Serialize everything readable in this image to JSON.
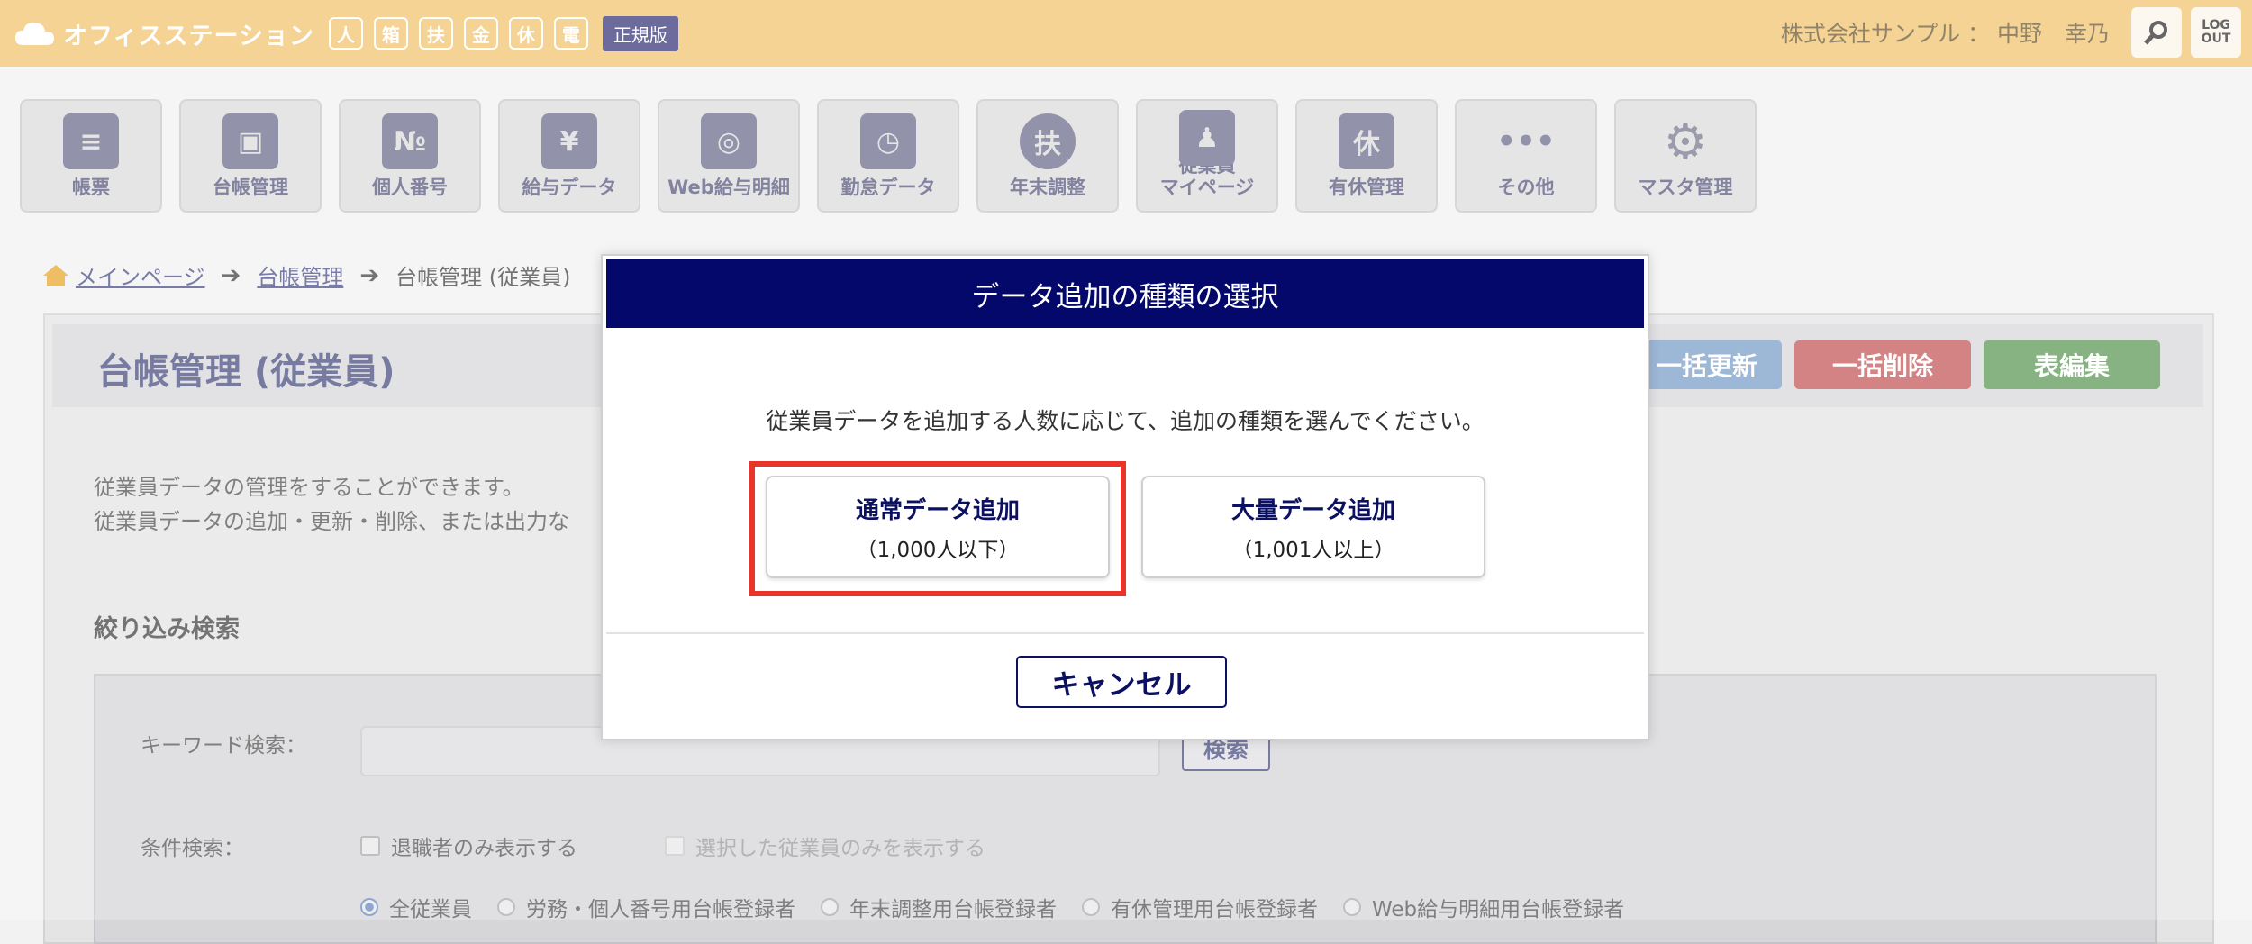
{
  "app": {
    "logo_text": "オフィスステーション",
    "mini_icons": [
      "人",
      "箱",
      "扶",
      "金",
      "休",
      "電"
    ],
    "edition_badge": "正規版",
    "user_label": "株式会社サンプル ： 中野　幸乃",
    "logout_label": "LOG OUT"
  },
  "nav": {
    "items": [
      {
        "label": "帳票",
        "glyph": "≡"
      },
      {
        "label": "台帳管理",
        "glyph": "▣"
      },
      {
        "label": "個人番号",
        "glyph": "№"
      },
      {
        "label": "給与データ",
        "glyph": "¥"
      },
      {
        "label": "Web給与明細",
        "glyph": "◎"
      },
      {
        "label": "勤怠データ",
        "glyph": "◷"
      },
      {
        "label": "年末調整",
        "glyph": "扶"
      },
      {
        "label": "従業員\nマイページ",
        "glyph": "♟"
      },
      {
        "label": "有休管理",
        "glyph": "休"
      },
      {
        "label": "その他",
        "glyph": "•••"
      },
      {
        "label": "マスタ管理",
        "glyph": "⚙"
      }
    ]
  },
  "breadcrumb": {
    "home": "メインページ",
    "section": "台帳管理",
    "current": "台帳管理 (従業員)"
  },
  "page": {
    "title": "台帳管理 (従業員)",
    "btn_bulk_update": "一括更新",
    "btn_bulk_delete": "一括削除",
    "btn_table_edit": "表編集",
    "desc_line1": "従業員データの管理をすることができます。",
    "desc_line2": "従業員データの追加・更新・削除、または出力な"
  },
  "filter": {
    "title": "絞り込み検索",
    "keyword_label": "キーワード検索：",
    "keyword_value": "",
    "search_button": "検索",
    "condition_label": "条件検索：",
    "cb_retired": "退職者のみ表示する",
    "cb_selected": "選択した従業員のみを表示する",
    "radios": [
      {
        "label": "全従業員",
        "checked": true
      },
      {
        "label": "労務・個人番号用台帳登録者",
        "checked": false
      },
      {
        "label": "年末調整用台帳登録者",
        "checked": false
      },
      {
        "label": "有休管理用台帳登録者",
        "checked": false
      },
      {
        "label": "Web給与明細用台帳登録者",
        "checked": false
      }
    ]
  },
  "modal": {
    "title": "データ追加の種類の選択",
    "message": "従業員データを追加する人数に応じて、追加の種類を選んでください。",
    "normal_main": "通常データ追加",
    "normal_sub": "（1,000人以下）",
    "bulk_main": "大量データ追加",
    "bulk_sub": "（1,001人以上）",
    "cancel": "キャンセル"
  },
  "colors": {
    "topbar": "#f1c470",
    "modal_header": "#03086a",
    "highlight": "#e8342a"
  }
}
